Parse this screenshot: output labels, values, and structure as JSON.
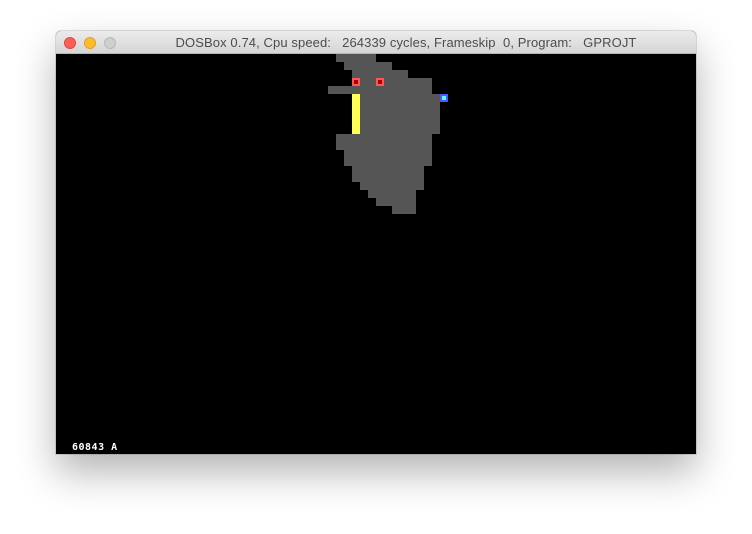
{
  "window": {
    "title": "DOSBox 0.74, Cpu speed:   264339 cycles, Frameskip  0, Program:   GPROJT"
  },
  "screen": {
    "status_counter": "60843",
    "status_letter": "A",
    "colors": {
      "background": "#000000",
      "shape": "#555555",
      "bar": "#ffff55",
      "red_marker": "#ff5555",
      "blue_marker": "#5555ff"
    }
  }
}
